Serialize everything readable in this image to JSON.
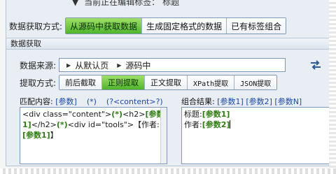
{
  "current_tag": {
    "text": "当前正在编辑标签：",
    "value": "标题"
  },
  "fetch_mode": {
    "label": "数据获取方式:",
    "options": [
      "从源码中获取数据",
      "生成固定格式的数据",
      "已有标签组合"
    ],
    "selected": 0
  },
  "section": {
    "title": "数据获取"
  },
  "source": {
    "label": "数据来源:",
    "path": [
      "从默认页",
      "源码中"
    ]
  },
  "extract": {
    "label": "提取方式:",
    "options": [
      "前后截取",
      "正则提取",
      "正文提取",
      "XPath提取",
      "JSON提取"
    ],
    "selected": 1
  },
  "match": {
    "label": "匹配内容:",
    "param_link": "[参数]",
    "wildcard": "(*)",
    "content_link": "(?<content>?)",
    "editor": {
      "p1": "<div class=\"content\">",
      "p2": "(*)",
      "p3": "<h2>",
      "p4": "[参数1]",
      "p5": "</h2>",
      "p6": "(*)",
      "p7": "<div id=\"tools\">【作者:",
      "p8": "[参数1]",
      "p9": "】"
    }
  },
  "combine": {
    "label": "组合结果:",
    "param_links": [
      "[参数1]",
      "[参数2]",
      "[参数N]"
    ],
    "editor": {
      "line1_label": "标题:",
      "line1_param": "[参数1]",
      "line2_label": "作者:",
      "line2_param": "[参数2]"
    }
  },
  "colors": {
    "active_segment": "#4fb52a",
    "param_blue": "#1b48a8",
    "param_green": "#2e7d10"
  }
}
